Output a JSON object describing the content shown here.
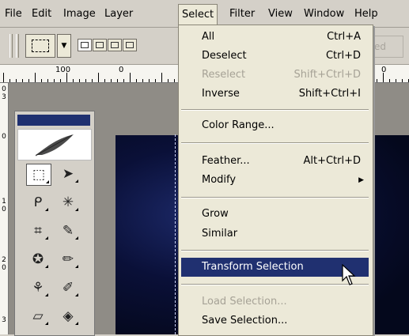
{
  "menubar": {
    "items": [
      "File",
      "Edit",
      "Image",
      "Layer",
      "Select",
      "Filter",
      "View",
      "Window",
      "Help"
    ],
    "active_index": 4
  },
  "options_bar": {
    "greyed_button": "ed"
  },
  "ruler": {
    "labels": [
      "100",
      "0",
      "0"
    ]
  },
  "vruler": {
    "labels": [
      "0",
      "3",
      "0",
      "1",
      "0",
      "2",
      "0",
      "3"
    ]
  },
  "select_menu": {
    "items": [
      {
        "label": "All",
        "shortcut": "Ctrl+A",
        "state": "enabled"
      },
      {
        "label": "Deselect",
        "shortcut": "Ctrl+D",
        "state": "enabled"
      },
      {
        "label": "Reselect",
        "shortcut": "Shift+Ctrl+D",
        "state": "disabled"
      },
      {
        "label": "Inverse",
        "shortcut": "Shift+Ctrl+I",
        "state": "enabled"
      },
      {
        "label": "Color Range...",
        "shortcut": "",
        "state": "enabled"
      },
      {
        "label": "Feather...",
        "shortcut": "Alt+Ctrl+D",
        "state": "enabled"
      },
      {
        "label": "Modify",
        "shortcut": "",
        "state": "submenu"
      },
      {
        "label": "Grow",
        "shortcut": "",
        "state": "enabled"
      },
      {
        "label": "Similar",
        "shortcut": "",
        "state": "enabled"
      },
      {
        "label": "Transform Selection",
        "shortcut": "",
        "state": "highlighted"
      },
      {
        "label": "Load Selection...",
        "shortcut": "",
        "state": "disabled"
      },
      {
        "label": "Save Selection...",
        "shortcut": "",
        "state": "enabled"
      }
    ]
  },
  "toolbox": {
    "tools": [
      {
        "icon": "rectangular-marquee-icon",
        "glyph": "⬚"
      },
      {
        "icon": "move-icon",
        "glyph": "➤"
      },
      {
        "icon": "lasso-icon",
        "glyph": "ᑭ"
      },
      {
        "icon": "magic-wand-icon",
        "glyph": "✳"
      },
      {
        "icon": "crop-icon",
        "glyph": "⌗"
      },
      {
        "icon": "slice-icon",
        "glyph": "✎"
      },
      {
        "icon": "healing-brush-icon",
        "glyph": "✪"
      },
      {
        "icon": "brush-icon",
        "glyph": "✏"
      },
      {
        "icon": "clone-stamp-icon",
        "glyph": "⚘"
      },
      {
        "icon": "history-brush-icon",
        "glyph": "✐"
      },
      {
        "icon": "eraser-icon",
        "glyph": "▱"
      },
      {
        "icon": "paint-bucket-icon",
        "glyph": "◈"
      }
    ]
  },
  "colors": {
    "highlight": "#203070",
    "menu_bg": "#ece9d8",
    "chrome_bg": "#d4d0c8",
    "disabled_text": "#a6a296"
  }
}
